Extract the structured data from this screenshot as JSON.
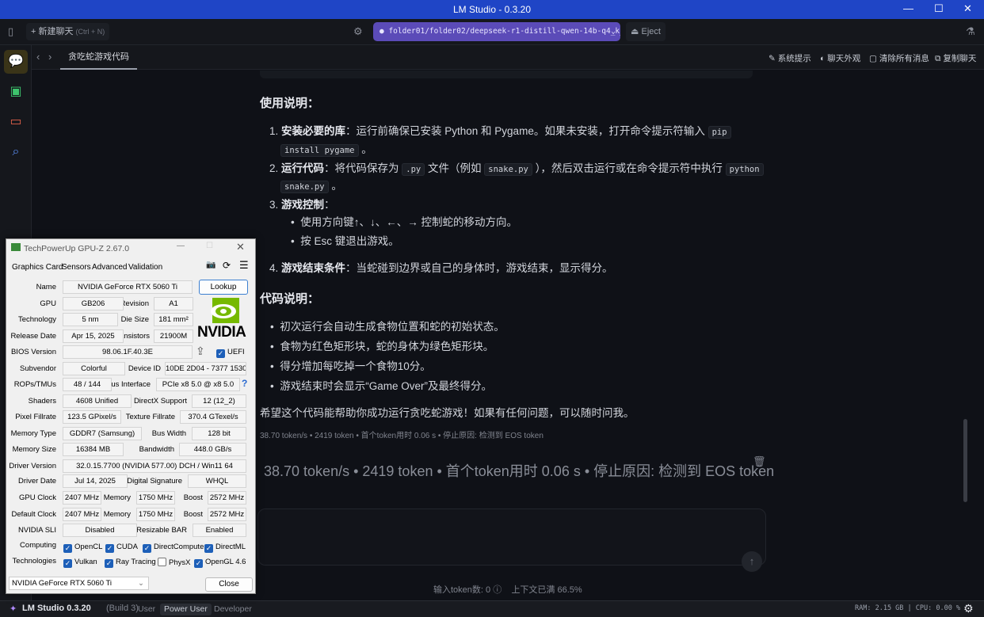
{
  "window": {
    "title": "LM Studio - 0.3.20"
  },
  "toolbar": {
    "new_chat": "+ 新建聊天",
    "new_chat_shortcut": "(Ctrl + N)",
    "model": "folder01/folder02/deepseek-r1-distill-qwen-14b-q4_k_m…",
    "eject": "Eject"
  },
  "tabbar": {
    "tab": "贪吃蛇游戏代码",
    "actions": [
      "系统提示",
      "聊天外观",
      "清除所有消息",
      "复制聊天"
    ]
  },
  "content": {
    "h1": "使用说明：",
    "s1_bold": "安装必要的库",
    "s1_text": "：运行前确保已安装 Python 和 Pygame。如果未安装，打开命令提示符输入",
    "s1_code1": "pip",
    "s1_code2": "install pygame",
    "s1_end": "。",
    "s2_bold": "运行代码",
    "s2_text1": "：将代码保存为",
    "s2_code1": ".py",
    "s2_text2": "文件（例如",
    "s2_code2": "snake.py",
    "s2_text3": "），然后双击运行或在命令提示符中执行",
    "s2_code3": "python",
    "s2_code4": "snake.py",
    "s2_end": "。",
    "s3_bold": "游戏控制",
    "s3_colon": "：",
    "s3_b1": "使用方向键↑、↓、←、→ 控制蛇的移动方向。",
    "s3_b2": "按 Esc 键退出游戏。",
    "s4_bold": "游戏结束条件",
    "s4_text": "：当蛇碰到边界或自己的身体时，游戏结束，显示得分。",
    "h2": "代码说明：",
    "bullets": [
      "初次运行会自动生成食物位置和蛇的初始状态。",
      "食物为红色矩形块，蛇的身体为绿色矩形块。",
      "得分增加每吃掉一个食物10分。",
      "游戏结束时会显示“Game Over”及最终得分。"
    ],
    "closing": "希望这个代码能帮助你成功运行贪吃蛇游戏！如果有任何问题，可以随时问我。",
    "meta": "38.70 token/s • 2419 token • 首个token用时 0.06 s • 停止原因: 检测到 EOS token"
  },
  "input": {
    "token_count_label": "输入token数:",
    "token_count": "0",
    "context": "上下文已满 66.5%"
  },
  "statusbar": {
    "app": "LM Studio 0.3.20",
    "build": "(Build 3)",
    "modes": [
      "User",
      "Power User",
      "Developer"
    ],
    "active_mode": "Power User",
    "resources": "RAM: 2.15 GB | CPU: 0.00 %"
  },
  "gpuz": {
    "title": "TechPowerUp GPU-Z 2.67.0",
    "tabs": [
      "Graphics Card",
      "Sensors",
      "Advanced",
      "Validation"
    ],
    "labels": {
      "name": "Name",
      "gpu": "GPU",
      "revision": "Revision",
      "technology": "Technology",
      "die_size": "Die Size",
      "release_date": "Release Date",
      "transistors": "Transistors",
      "bios": "BIOS Version",
      "subvendor": "Subvendor",
      "device_id": "Device ID",
      "rops": "ROPs/TMUs",
      "bus": "Bus Interface",
      "shaders": "Shaders",
      "directx": "DirectX Support",
      "pixel": "Pixel Fillrate",
      "texture": "Texture Fillrate",
      "memtype": "Memory Type",
      "buswidth": "Bus Width",
      "memsize": "Memory Size",
      "bandwidth": "Bandwidth",
      "driver": "Driver Version",
      "driver_date": "Driver Date",
      "digsig": "Digital Signature",
      "gpuclock": "GPU Clock",
      "memory": "Memory",
      "boost": "Boost",
      "defclock": "Default Clock",
      "sli": "NVIDIA SLI",
      "rebar": "Resizable BAR",
      "computing": "Computing",
      "technologies": "Technologies"
    },
    "values": {
      "name": "NVIDIA GeForce RTX 5060 Ti",
      "gpu": "GB206",
      "revision": "A1",
      "technology": "5 nm",
      "die_size": "181 mm²",
      "release_date": "Apr 15, 2025",
      "transistors": "21900M",
      "bios": "98.06.1F.40.3E",
      "subvendor": "Colorful",
      "device_id": "10DE 2D04 - 7377 1530",
      "rops": "48 / 144",
      "bus": "PCIe x8 5.0 @ x8 5.0",
      "shaders": "4608 Unified",
      "directx": "12 (12_2)",
      "pixel": "123.5 GPixel/s",
      "texture": "370.4 GTexel/s",
      "memtype": "GDDR7 (Samsung)",
      "buswidth": "128 bit",
      "memsize": "16384 MB",
      "bandwidth": "448.0 GB/s",
      "driver": "32.0.15.7700 (NVIDIA 577.00) DCH / Win11 64",
      "driver_date": "Jul 14, 2025",
      "digsig": "WHQL",
      "gpuclock": "2407 MHz",
      "gpumem": "1750 MHz",
      "gpuboost": "2572 MHz",
      "defclock": "2407 MHz",
      "defmem": "1750 MHz",
      "defboost": "2572 MHz",
      "sli": "Disabled",
      "rebar": "Enabled"
    },
    "uefi": {
      "label": "UEFI",
      "checked": true
    },
    "computing": [
      {
        "label": "OpenCL",
        "checked": true
      },
      {
        "label": "CUDA",
        "checked": true
      },
      {
        "label": "DirectCompute",
        "checked": true
      },
      {
        "label": "DirectML",
        "checked": true
      }
    ],
    "technologies": [
      {
        "label": "Vulkan",
        "checked": true
      },
      {
        "label": "Ray Tracing",
        "checked": true
      },
      {
        "label": "PhysX",
        "checked": false
      },
      {
        "label": "OpenGL 4.6",
        "checked": true
      }
    ],
    "lookup": "Lookup",
    "logo": "NVIDIA",
    "selected_gpu": "NVIDIA GeForce RTX 5060 Ti",
    "close": "Close",
    "help": "?"
  },
  "colors": {
    "titlebar": "#1f45c6",
    "model_pill": "#5b4bb8",
    "chat_active": "#e2c23a"
  }
}
